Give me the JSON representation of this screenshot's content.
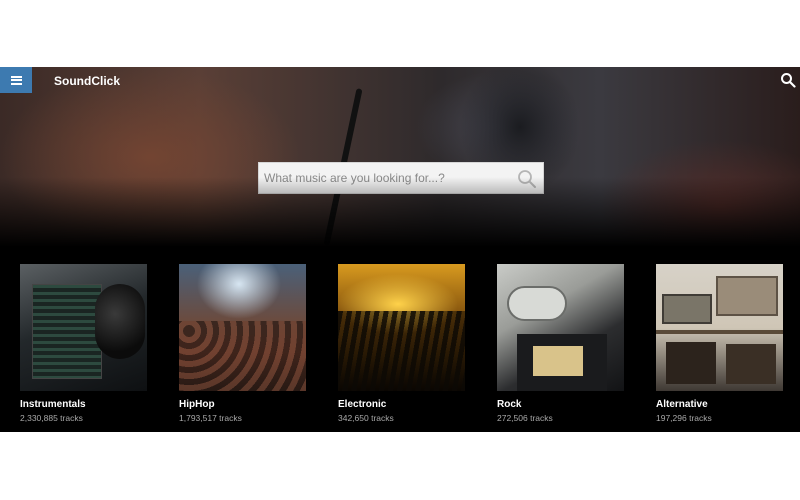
{
  "app": {
    "brand": "SoundClick"
  },
  "search": {
    "placeholder": "What music are you looking for...?"
  },
  "genres": [
    {
      "name": "Instrumentals",
      "count": "2,330,885 tracks"
    },
    {
      "name": "HipHop",
      "count": "1,793,517 tracks"
    },
    {
      "name": "Electronic",
      "count": "342,650 tracks"
    },
    {
      "name": "Rock",
      "count": "272,506 tracks"
    },
    {
      "name": "Alternative",
      "count": "197,296 tracks"
    }
  ],
  "icons": {
    "menu": "menu-icon",
    "search": "search-icon"
  },
  "colors": {
    "menu_button": "#3d7ab0",
    "background": "#000000",
    "text_primary": "#ffffff",
    "text_secondary": "#a9a9a9"
  }
}
